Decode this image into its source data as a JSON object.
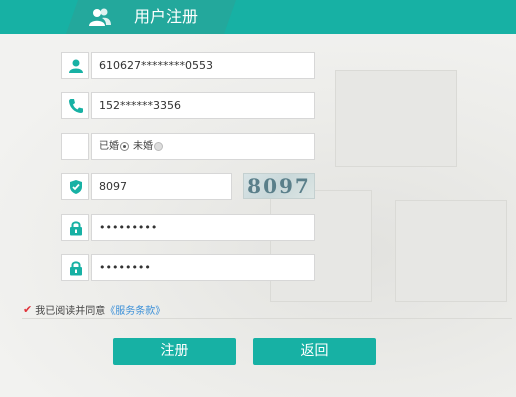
{
  "header": {
    "title": "用户注册",
    "icon": "users-icon"
  },
  "form": {
    "id_card": {
      "value": "610627********0553",
      "icon": "user-icon"
    },
    "phone": {
      "value": "152******3356",
      "icon": "phone-icon"
    },
    "marital": {
      "option_married": "已婚",
      "option_single": "未婚",
      "selected": "已婚"
    },
    "captcha": {
      "value": "8097",
      "image_text": "8097",
      "icon": "shield-check-icon"
    },
    "password": {
      "value": "•••••••••",
      "icon": "lock-icon"
    },
    "confirm_password": {
      "value": "••••••••",
      "icon": "lock-icon"
    }
  },
  "agreement": {
    "text": "我已阅读并同意",
    "link": "《服务条款》"
  },
  "buttons": {
    "register": "注册",
    "back": "返回"
  },
  "colors": {
    "accent": "#17b1a4",
    "link": "#3a8fd8",
    "check": "#e0323a"
  }
}
